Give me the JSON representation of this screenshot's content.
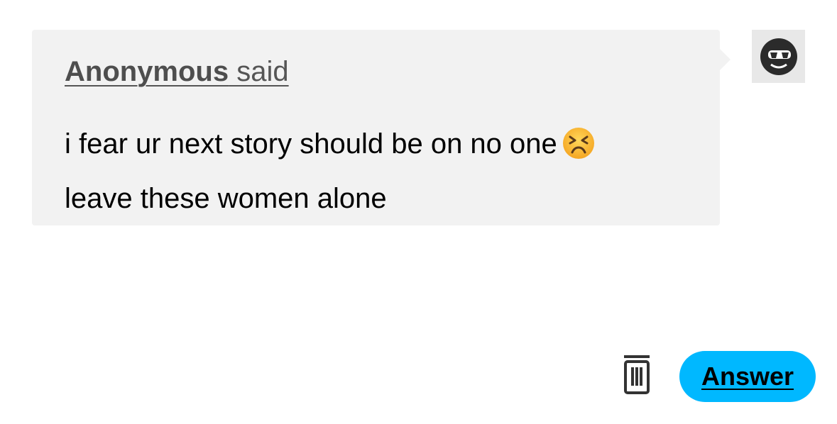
{
  "ask": {
    "asker_name": "Anonymous",
    "asker_suffix": " said",
    "question_line_1": "i fear ur next story should be on no one",
    "question_line_2": "leave these women alone",
    "emoji_icon": "persevering-face-icon"
  },
  "avatar": {
    "icon": "sunglasses-face-avatar-icon"
  },
  "actions": {
    "delete_icon": "trash-icon",
    "answer_label": "Answer",
    "answer_color": "#00b8ff"
  },
  "colors": {
    "bubble_background": "#f2f2f2",
    "page_background": "#ffffff"
  }
}
